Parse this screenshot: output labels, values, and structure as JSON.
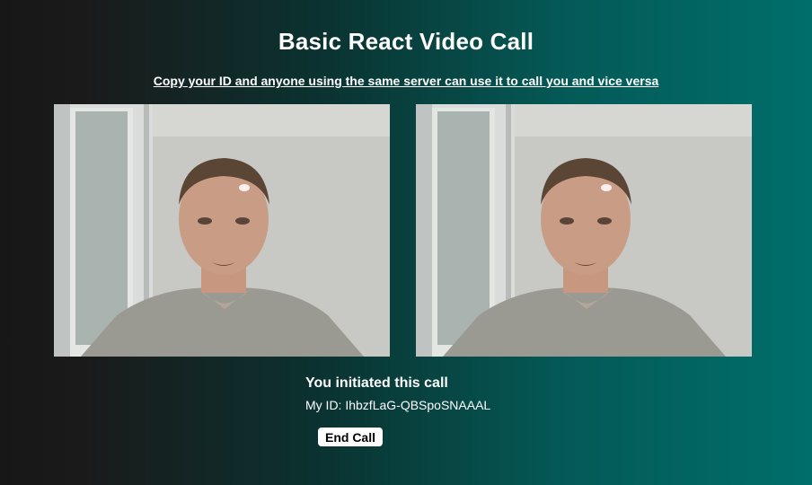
{
  "app": {
    "title": "Basic React Video Call",
    "subtitle": "Copy your ID and anyone using the same server can use it to call you and vice versa"
  },
  "videos": [
    {
      "label": "local-video"
    },
    {
      "label": "remote-video"
    }
  ],
  "call": {
    "status": "You initiated this call",
    "my_id_prefix": "My ID:",
    "my_id_value": "IhbzfLaG-QBSpoSNAAAL",
    "end_call_label": "End Call"
  },
  "colors": {
    "background_start": "#171717",
    "background_end": "#006e6b",
    "button_bg": "#ffffff"
  }
}
